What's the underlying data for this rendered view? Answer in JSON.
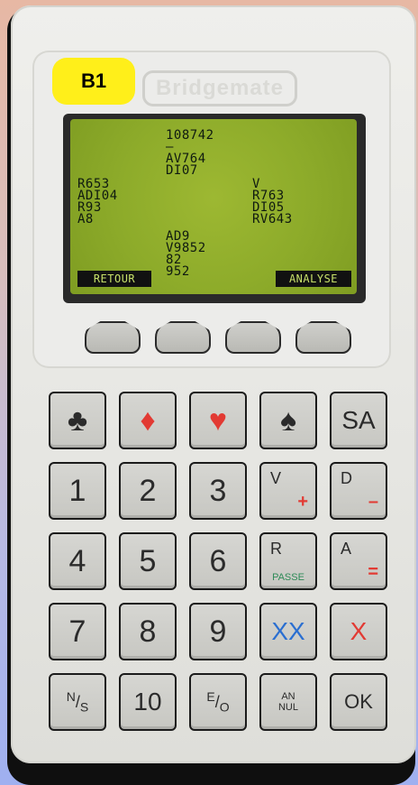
{
  "device": {
    "badge_text": "B1",
    "brand_text": "Bridgemate"
  },
  "lcd": {
    "north_lines": [
      "108742",
      "—",
      "AV764",
      "DI07"
    ],
    "west_lines": [
      "R653",
      "ADI04",
      "R93",
      "A8"
    ],
    "east_lines": [
      "V",
      "R763",
      "DI05",
      "RV643"
    ],
    "south_lines": [
      "AD9",
      "V9852",
      "82",
      "952"
    ],
    "soft_left_label": "RETOUR",
    "soft_right_label": "ANALYSE"
  },
  "keypad": {
    "row1": [
      {
        "id": "club",
        "icon": "club-icon",
        "glyph": "♣",
        "color": "black"
      },
      {
        "id": "diamond",
        "icon": "diamond-icon",
        "glyph": "♦",
        "color": "red"
      },
      {
        "id": "heart",
        "icon": "heart-icon",
        "glyph": "♥",
        "color": "red"
      },
      {
        "id": "spade",
        "icon": "spade-icon",
        "glyph": "♠",
        "color": "black"
      },
      {
        "id": "sa",
        "label": "SA"
      }
    ],
    "digits": {
      "one": "1",
      "two": "2",
      "three": "3",
      "four": "4",
      "five": "5",
      "six": "6",
      "seven": "7",
      "eight": "8",
      "nine": "9"
    },
    "v": {
      "main": "V",
      "sub": "+",
      "sub_color": "#e23a33"
    },
    "d": {
      "main": "D",
      "sub": "–",
      "sub_color": "#e23a33"
    },
    "r": {
      "main": "R",
      "sub": "PASSE",
      "sub_color": "#2e8b57"
    },
    "a": {
      "main": "A",
      "sub": "=",
      "sub_color": "#e23a33"
    },
    "xx": {
      "label": "XX",
      "color": "#2b6fd1"
    },
    "x": {
      "label": "X",
      "color": "#e23a33"
    },
    "ns": {
      "top": "N",
      "bottom": "S"
    },
    "ten": {
      "label": "10"
    },
    "eo": {
      "top": "E",
      "bottom": "O"
    },
    "annul": {
      "line1": "AN",
      "line2": "NUL"
    },
    "ok": {
      "label": "OK"
    }
  }
}
